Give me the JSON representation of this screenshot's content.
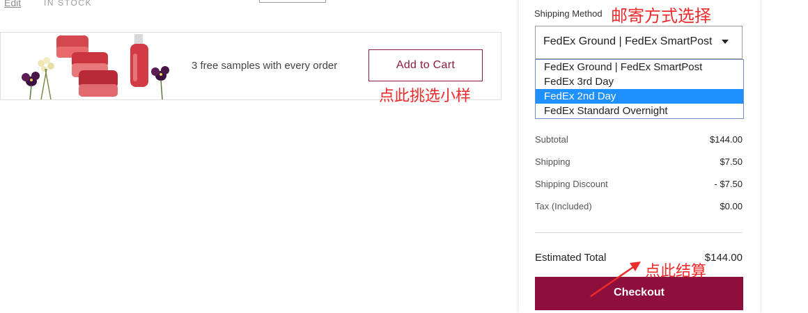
{
  "item": {
    "edit_label": "Edit",
    "stock_status": "IN STOCK"
  },
  "promo": {
    "text": "3 free samples with every order",
    "button_label": "Add to Cart",
    "annotation": "点此挑选小样"
  },
  "summary": {
    "shipping_method_label": "Shipping Method",
    "shipping_annotation": "邮寄方式选择",
    "selected_method": "FedEx Ground | FedEx SmartPost",
    "options": [
      "FedEx Ground | FedEx SmartPost",
      "FedEx 3rd Day",
      "FedEx 2nd Day",
      "FedEx Standard Overnight"
    ],
    "highlighted_option": "FedEx 2nd Day",
    "rows": [
      {
        "label": "Subtotal",
        "value": "$144.00"
      },
      {
        "label": "Shipping",
        "value": "$7.50"
      },
      {
        "label": "Shipping Discount",
        "value": "- $7.50"
      },
      {
        "label": "Tax (Included)",
        "value": "$0.00"
      }
    ],
    "estimated_total_label": "Estimated Total",
    "estimated_total_value": "$144.00",
    "checkout_label": "Checkout",
    "checkout_annotation": "点此结算"
  },
  "colors": {
    "brand": "#8e0e3c",
    "annotation": "#ee2a2a",
    "highlight": "#1e90ff"
  }
}
